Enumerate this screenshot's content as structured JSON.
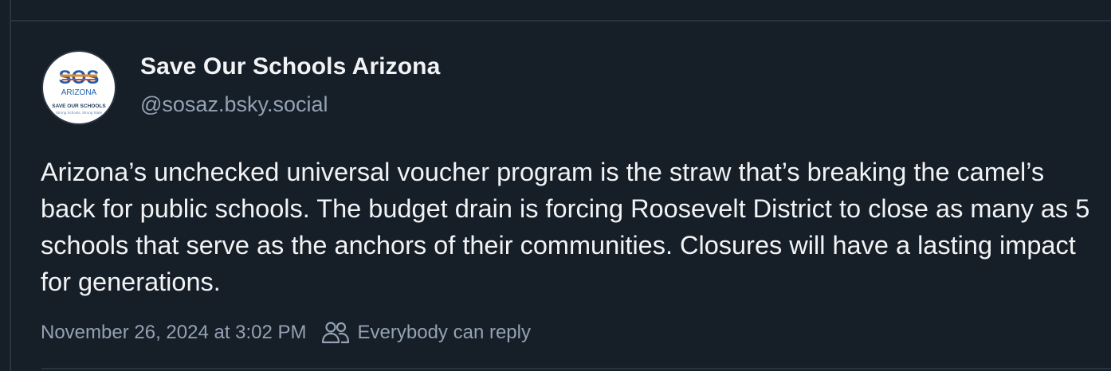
{
  "post": {
    "author": {
      "display_name": "Save Our Schools Arizona",
      "handle": "@sosaz.bsky.social",
      "avatar": {
        "logo_text": "SOS",
        "subtitle": "ARIZONA",
        "caption": "SAVE OUR SCHOOLS",
        "tagline": "Strong Schools, Strong State"
      }
    },
    "text": "Arizona’s unchecked universal voucher program is the straw that’s breaking the camel’s back for public schools. The budget drain is forcing Roosevelt District to close as many as 5 schools that serve as the anchors of their communities. Closures will have a lasting impact for generations.",
    "timestamp": "November 26, 2024 at 3:02 PM",
    "reply_setting": "Everybody can reply",
    "reply_icon": "people-icon"
  },
  "colors": {
    "background": "#161e27",
    "primary_text": "#f1f3f5",
    "secondary_text": "#93a2b4",
    "divider": "#2a3440"
  }
}
